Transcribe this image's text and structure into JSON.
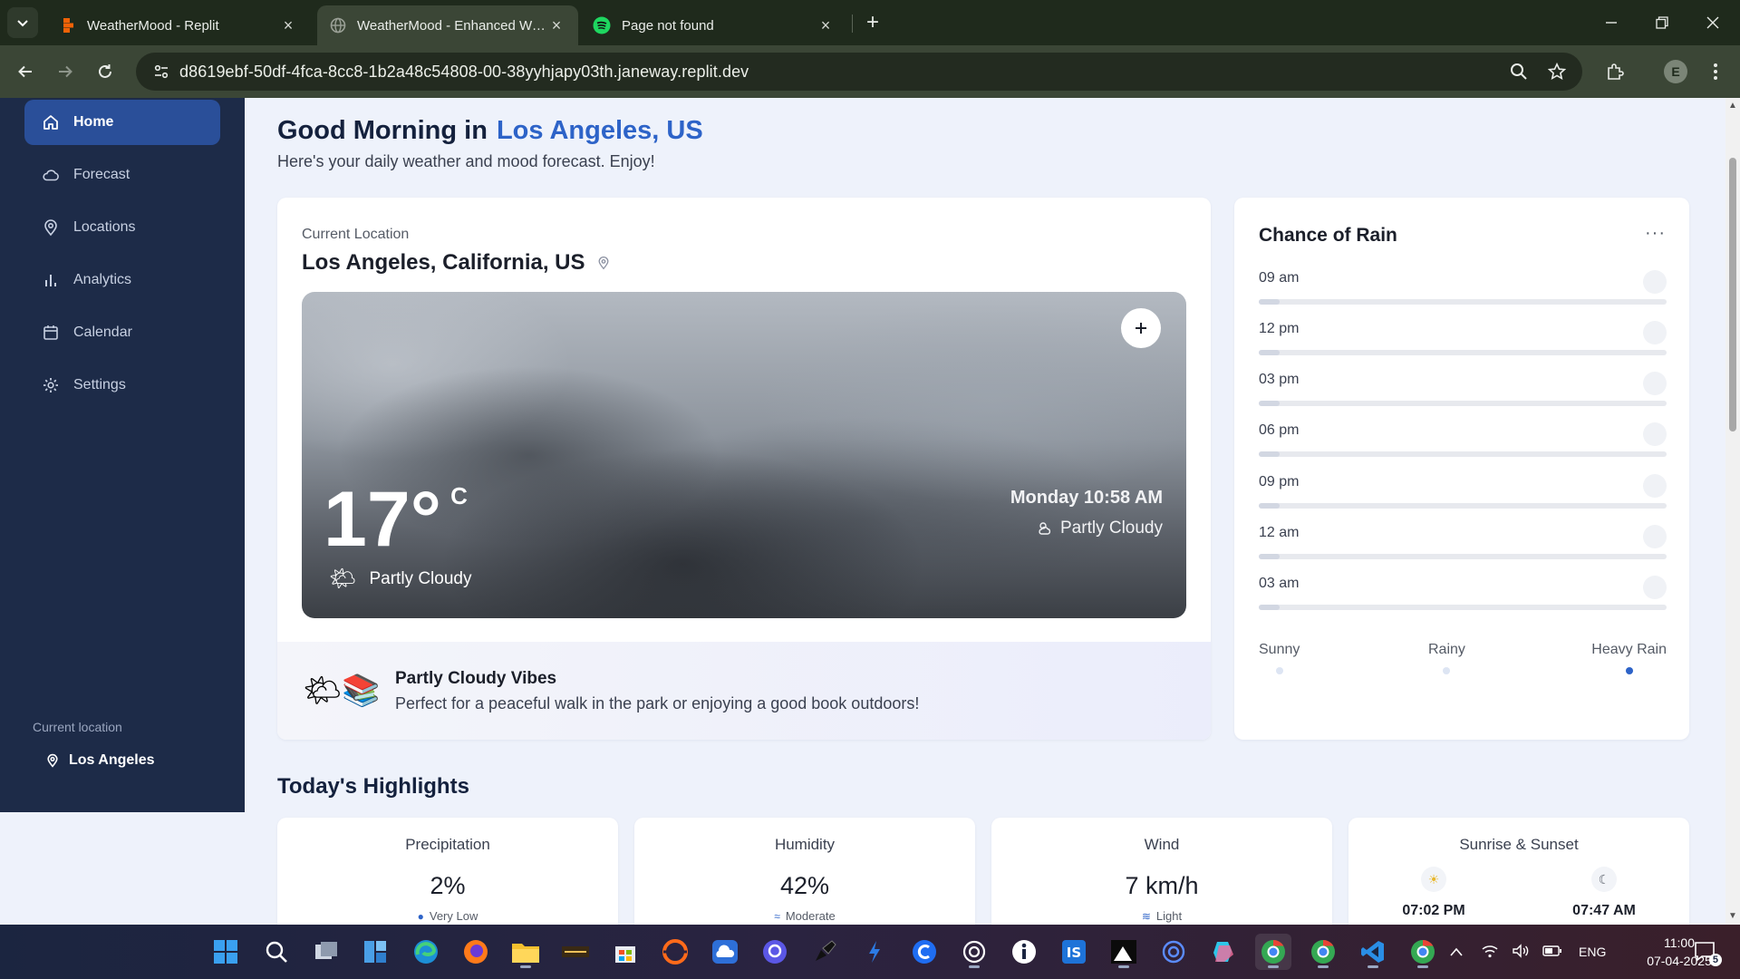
{
  "browser": {
    "tabs": [
      {
        "title": "WeatherMood - Replit",
        "favicon": "replit-icon"
      },
      {
        "title": "WeatherMood - Enhanced Weather",
        "favicon": "globe-icon"
      },
      {
        "title": "Page not found",
        "favicon": "spotify-icon"
      }
    ],
    "url": "d8619ebf-50df-4fca-8cc8-1b2a48c54808-00-38yyhjapy03th.janeway.replit.dev",
    "profile_initial": "E"
  },
  "sidebar": {
    "items": [
      {
        "label": "Home",
        "icon": "home-icon"
      },
      {
        "label": "Forecast",
        "icon": "cloud-icon"
      },
      {
        "label": "Locations",
        "icon": "map-pin-icon"
      },
      {
        "label": "Analytics",
        "icon": "bar-chart-icon"
      },
      {
        "label": "Calendar",
        "icon": "calendar-icon"
      },
      {
        "label": "Settings",
        "icon": "gear-icon"
      }
    ],
    "footer_label": "Current location",
    "footer_location": "Los Angeles"
  },
  "header": {
    "greeting": "Good Morning in",
    "location": "Los Angeles, US",
    "subtitle": "Here's your daily weather and mood forecast. Enjoy!"
  },
  "current": {
    "label": "Current Location",
    "city": "Los Angeles, California, US",
    "temperature": "17°",
    "unit": "C",
    "condition": "Partly Cloudy",
    "condition_emoji": "🌤",
    "datetime": "Monday 10:58 AM",
    "condition_right": "Partly Cloudy"
  },
  "vibes": {
    "emoji": "🌤📚",
    "title": "Partly Cloudy Vibes",
    "text": "Perfect for a peaceful walk in the park or enjoying a good book outdoors!"
  },
  "rain": {
    "title": "Chance of Rain",
    "rows": [
      {
        "time": "09 am",
        "value": 0.05
      },
      {
        "time": "12 pm",
        "value": 0.05
      },
      {
        "time": "03 pm",
        "value": 0.05
      },
      {
        "time": "06 pm",
        "value": 0.05
      },
      {
        "time": "09 pm",
        "value": 0.05
      },
      {
        "time": "12 am",
        "value": 0.05
      },
      {
        "time": "03 am",
        "value": 0.05
      }
    ],
    "legend": [
      "Sunny",
      "Rainy",
      "Heavy Rain"
    ],
    "legend_active": "Heavy Rain"
  },
  "highlights": {
    "title": "Today's Highlights",
    "precipitation": {
      "label": "Precipitation",
      "value": "2%",
      "sub": "Very Low"
    },
    "humidity": {
      "label": "Humidity",
      "value": "42%",
      "sub": "Moderate"
    },
    "wind": {
      "label": "Wind",
      "value": "7 km/h",
      "sub": "Light"
    },
    "sun": {
      "label": "Sunrise & Sunset",
      "sunset": "07:02 PM",
      "sunrise": "07:47 AM"
    }
  },
  "taskbar": {
    "language": "ENG",
    "time": "11:00",
    "date": "07-04-2025",
    "notifications": "5"
  },
  "colors": {
    "sidebar_bg": "#1d2b48",
    "accent": "#2d63c8",
    "page_bg": "#eef2fb"
  }
}
